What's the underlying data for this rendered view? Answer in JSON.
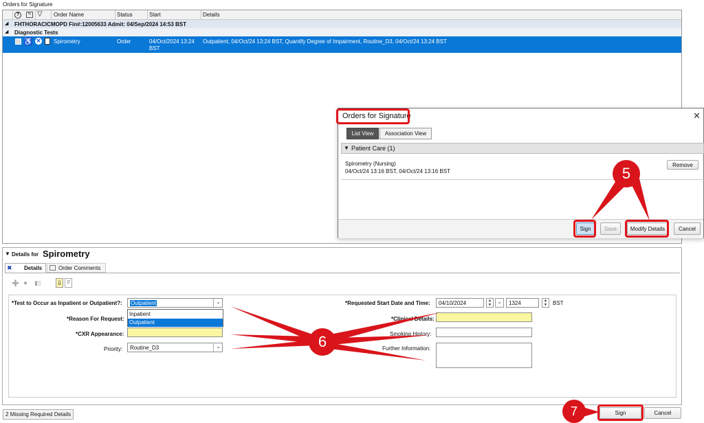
{
  "window_title": "Orders for Signature",
  "grid": {
    "columns": [
      "Order Name",
      "Status",
      "Start",
      "Details"
    ],
    "group_patient": "FHTHORACICMOPD  Fin#:12005633  Admit: 04/Sep/2024 14:53 BST",
    "group_category": "Diagnostic Tests",
    "row": {
      "name": "Spirometry",
      "status": "Order",
      "start_line1": "04/Oct/2024 13:24",
      "start_line2": "BST",
      "details": "Outpatient, 04/Oct/24 13:24 BST, Quantify Degree of Impairment, Routine_D3, 04/Oct/24 13:24 BST"
    }
  },
  "dialog": {
    "title": "Orders for Signature",
    "close_glyph": "✕",
    "tab_list": "List View",
    "tab_assoc": "Association View",
    "section": "Patient Care (1)",
    "item_name": "Spirometry (Nursing)",
    "item_time": "04/Oct/24 13:16 BST, 04/Oct/24 13:16 BST",
    "remove": "Remove",
    "sign": "Sign",
    "save": "Save",
    "modify": "Modify Details",
    "cancel": "Cancel"
  },
  "details": {
    "prefix": "Details for",
    "title": "Spirometry",
    "tab_details": "Details",
    "tab_comments": "Order Comments",
    "fields": {
      "test_occur_label": "*Test to Occur as Inpatient or Outpatient?:",
      "test_occur_value": "Outpatient",
      "dropdown_options": [
        "Inpatient",
        "Outpatient"
      ],
      "reason_label": "*Reason For Request:",
      "cxr_label": "*CXR Appearance:",
      "priority_label": "Priority:",
      "priority_value": "Routine_D3",
      "start_label": "*Requested Start Date and Time:",
      "start_date": "04/10/2024",
      "start_time": "1324",
      "timezone": "BST",
      "clinical_label": "*Clinical Details:",
      "smoking_label": "Smoking History:",
      "further_label": "Further Information:"
    }
  },
  "status_bar": {
    "missing": "2 Missing Required Details",
    "sign": "Sign",
    "cancel": "Cancel"
  },
  "annotations": {
    "step5": "5",
    "step6": "6",
    "step7": "7",
    "accent_red": "#e0141b",
    "selection_blue": "#0a78d7"
  }
}
